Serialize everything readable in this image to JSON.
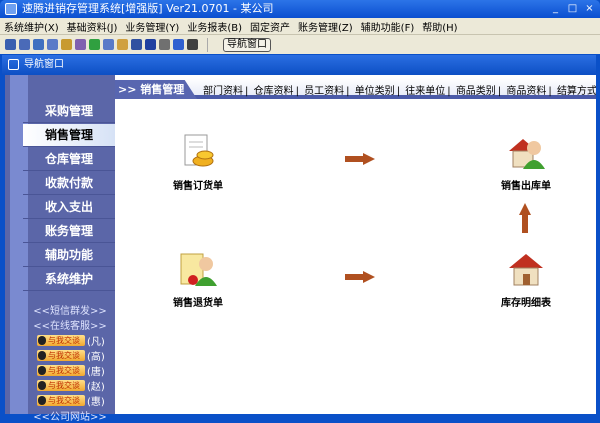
{
  "window": {
    "title": "速腾进销存管理系统[增强版] Ver21.0701  -  某公司",
    "controls": [
      "_",
      "□",
      "×"
    ]
  },
  "menu": [
    "系统维护(X)",
    "基础资料(J)",
    "业务管理(Y)",
    "业务报表(B)",
    "固定资产",
    "账务管理(Z)",
    "辅助功能(F)",
    "帮助(H)"
  ],
  "toolbar": {
    "nav_button": "导航窗口",
    "icon_colors": [
      "#3a5fb0",
      "#4a6ab8",
      "#4070c0",
      "#5a7ac8",
      "#c89a30",
      "#8060b0",
      "#30a040",
      "#5a7ac8",
      "#d0a040",
      "#3050a0",
      "#2040a0",
      "#707070",
      "#3060d0",
      "#404040"
    ]
  },
  "inner_window": {
    "title": "导航窗口"
  },
  "sidebar": {
    "items": [
      "采购管理",
      "销售管理",
      "仓库管理",
      "收款付款",
      "收入支出",
      "账务管理",
      "辅助功能",
      "系统维护"
    ],
    "active": 1,
    "links": [
      "<<短信群发>>",
      "<<在线客服>>",
      "<<公司网站>>"
    ],
    "qq_label": "与我交谈",
    "qq_agents": [
      "(凡)",
      "(高)",
      "(唐)",
      "(赵)",
      "(惠)"
    ]
  },
  "main": {
    "section": ">> 销售管理",
    "links": [
      "部门资料",
      "仓库资料",
      "员工资料",
      "单位类别",
      "往来单位",
      "商品类别",
      "商品资料",
      "结算方式"
    ],
    "separator": "|",
    "nodes": {
      "order": "销售订货单",
      "outbound": "销售出库单",
      "return": "销售退货单",
      "stock": "库存明细表"
    }
  }
}
